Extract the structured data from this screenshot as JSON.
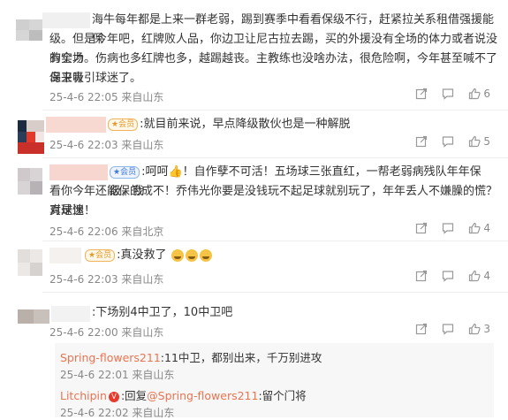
{
  "comments": [
    {
      "text": "海牛每年都是上来一群老弱，踢到赛季中看看保级不行，赶紧拉关系租借强援能保级。但是今年吧，红牌败人品，你边卫让尼古拉去踢，买的外援没有全场的体力或者说没有全场的实力。伤病也多红牌也多，越踢越丧。主教练也没啥办法，很危险啊，今年甚至喊不了保卫青岛来吸引球迷了。",
      "line1": "海牛每年都是上来一群老弱，踢到赛季中看看保级不行，赶紧拉关系租借强援能保",
      "line2": "级。但是今年吧，红牌败人品，你边卫让尼古拉去踢，买的外援没有全场的体力或者说没有全场",
      "line3": "的实力。伤病也多红牌也多，越踢越丧。主教练也没啥办法，很危险啊，今年甚至喊不了保卫青",
      "line4": "岛来吸引球迷了。",
      "meta": "25-4-6 22:05 来自山东",
      "likes": "6"
    },
    {
      "badge": "★会员",
      "text": ":就目前来说，早点降级散伙也是一种解脱",
      "meta": "25-4-6 22:03 来自山东",
      "likes": "5"
    },
    {
      "badge": "★会员",
      "line1": ":呵呵👍！自作孽不可活！五场球三张直红，一帮老弱病残队年年保级，我",
      "line2": "看你今年还能保的成不！乔伟光你要是没钱玩不起足球就别玩了，年年丢人不嫌臊的慌？真是愧",
      "line3": "对球迷！",
      "meta": "25-4-6 22:06 来自北京",
      "likes": "4"
    },
    {
      "badge": "★会员",
      "text": ":真没救了",
      "meta": "25-4-6 22:03 来自山东",
      "likes": "4"
    },
    {
      "text": ":下场别4中卫了，10中卫吧",
      "meta": "25-4-6 22:00 来自山东",
      "likes": "3",
      "replies": [
        {
          "name": "Spring-flowers211",
          "text": ":11中卫，都别出来，千万别进攻",
          "meta": "25-4-6 22:01 来自山东"
        },
        {
          "name": "Litchipin",
          "prefix": ":回复",
          "mention": "@Spring-flowers211",
          "text": ":留个门将",
          "meta": "25-4-6 22:02 来自山东"
        }
      ]
    }
  ],
  "colors": {
    "reply_name": "#eb7350",
    "meta": "#888888",
    "text": "#333333"
  },
  "icons": [
    "share-icon",
    "comment-icon",
    "like-icon"
  ]
}
